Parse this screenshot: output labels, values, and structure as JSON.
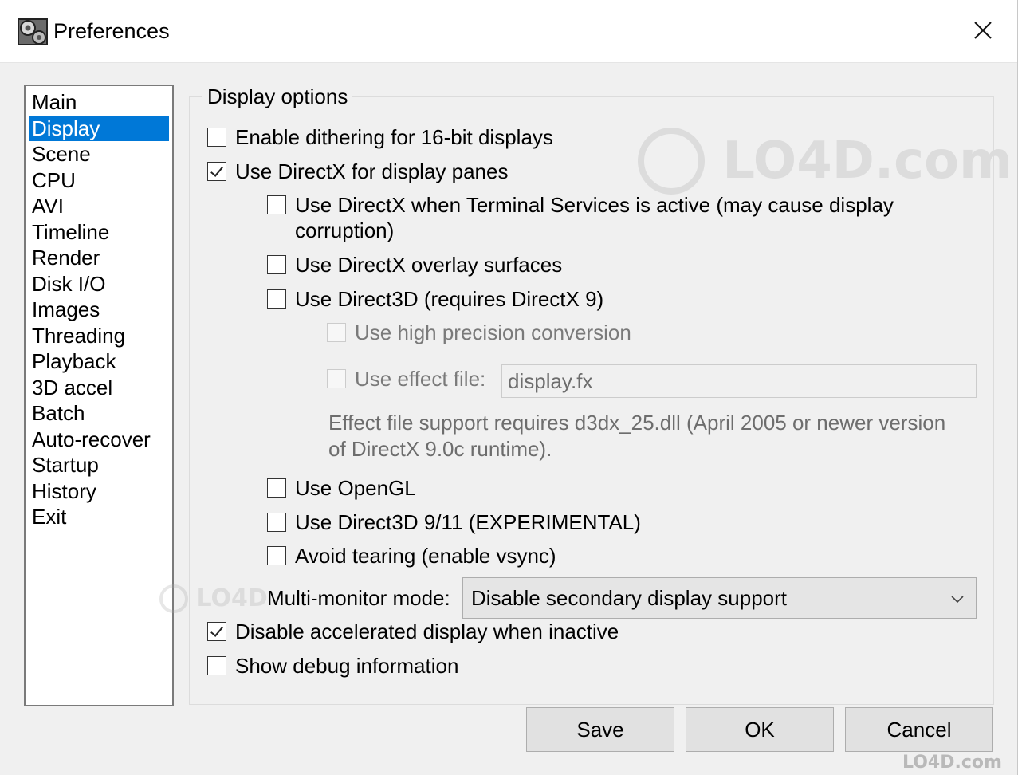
{
  "window": {
    "title": "Preferences",
    "close_glyph": "✕"
  },
  "sidebar": {
    "selected_index": 1,
    "items": [
      "Main",
      "Display",
      "Scene",
      "CPU",
      "AVI",
      "Timeline",
      "Render",
      "Disk I/O",
      "Images",
      "Threading",
      "Playback",
      "3D accel",
      "Batch",
      "Auto-recover",
      "Startup",
      "History",
      "Exit"
    ]
  },
  "display_options": {
    "group_title": "Display options",
    "dithering": {
      "label": "Enable dithering for 16-bit displays",
      "checked": false
    },
    "directx": {
      "label": "Use DirectX for display panes",
      "checked": true
    },
    "directx_terminal": {
      "label": "Use DirectX when Terminal Services is active (may cause display corruption)",
      "checked": false
    },
    "directx_overlay": {
      "label": "Use DirectX overlay surfaces",
      "checked": false
    },
    "direct3d": {
      "label": "Use Direct3D (requires DirectX 9)",
      "checked": false
    },
    "high_precision": {
      "label": "Use high precision conversion",
      "checked": false,
      "disabled": true
    },
    "effect_file": {
      "label": "Use effect file:",
      "checked": false,
      "disabled": true,
      "value": "display.fx"
    },
    "effect_note": "Effect file support requires d3dx_25.dll (April 2005 or newer version of DirectX 9.0c runtime).",
    "opengl": {
      "label": "Use OpenGL",
      "checked": false
    },
    "direct3d_911": {
      "label": "Use Direct3D 9/11 (EXPERIMENTAL)",
      "checked": false
    },
    "vsync": {
      "label": "Avoid tearing (enable vsync)",
      "checked": false
    },
    "multimonitor": {
      "label": "Multi-monitor mode:",
      "selected": "Disable secondary display support"
    },
    "disable_inactive": {
      "label": "Disable accelerated display when inactive",
      "checked": true
    },
    "debug": {
      "label": "Show debug information",
      "checked": false
    }
  },
  "buttons": {
    "save": "Save",
    "ok": "OK",
    "cancel": "Cancel"
  },
  "watermarks": {
    "center": "LO4D.com",
    "left": "LO4D",
    "corner": "LO4D.com"
  },
  "colors": {
    "selection": "#0078d7",
    "disabled_text": "#6d6d6d",
    "background": "#f0f0f0"
  }
}
